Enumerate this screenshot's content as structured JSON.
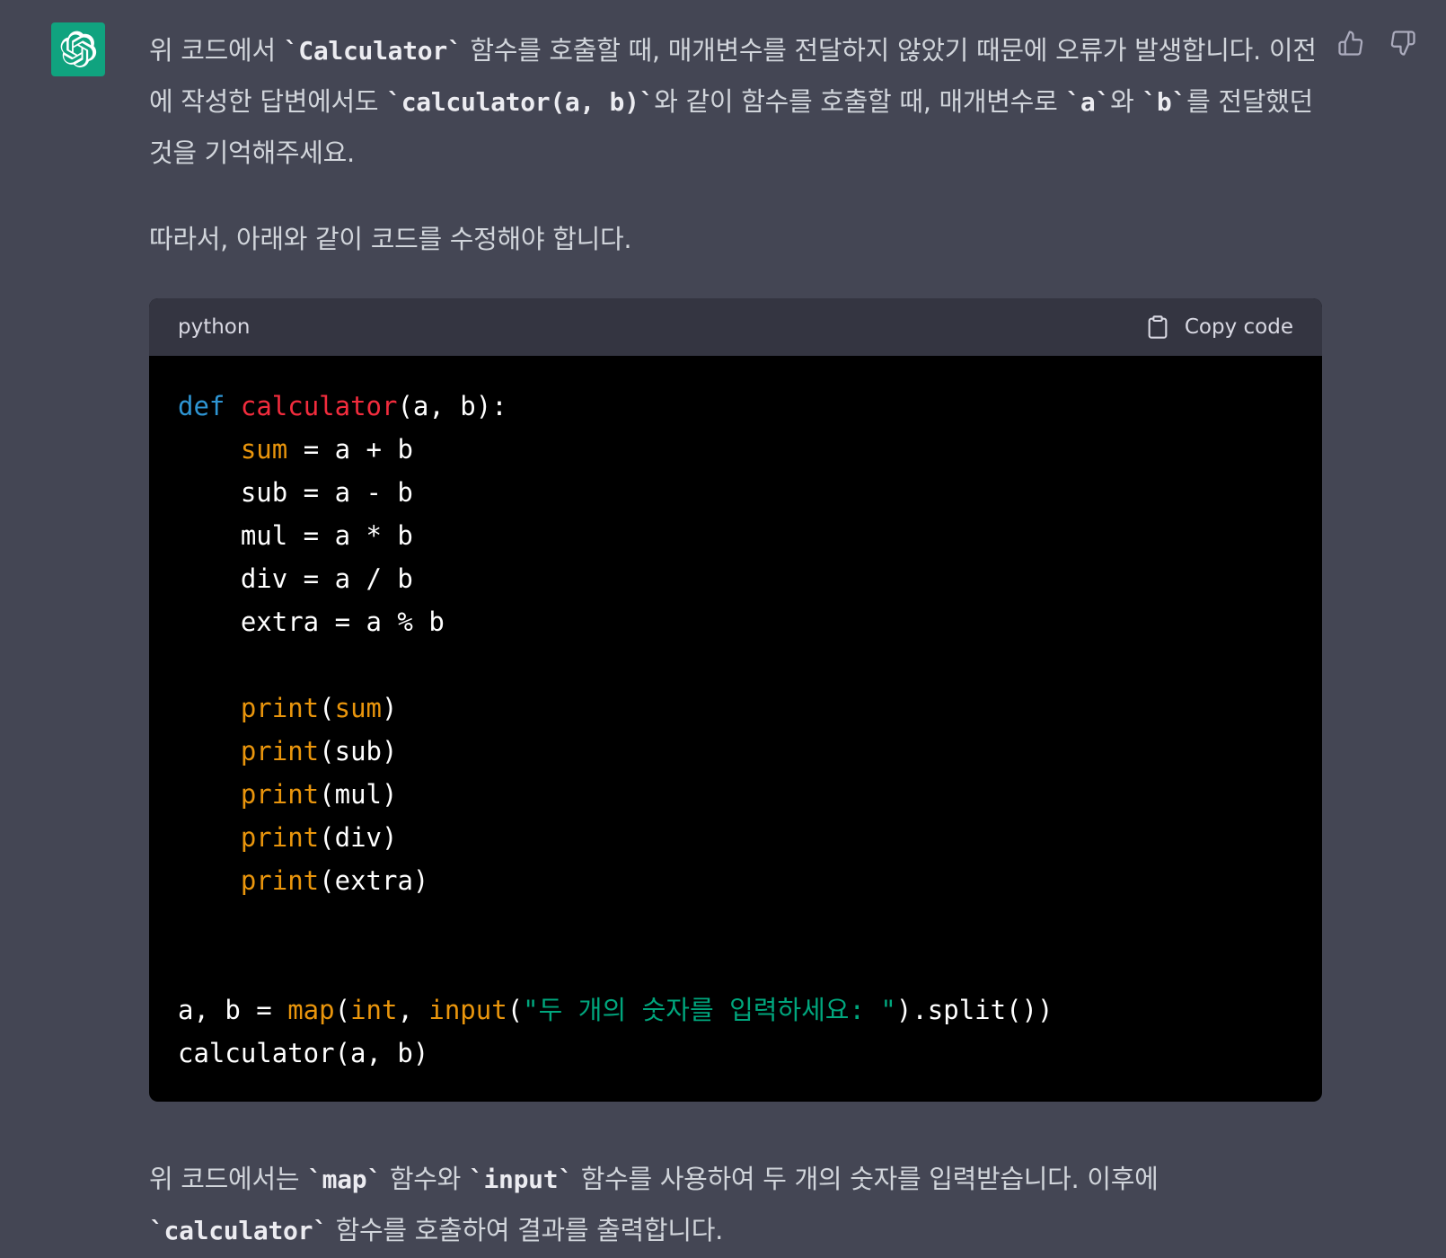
{
  "message": {
    "paragraph1": {
      "seg1": "위 코드에서 ",
      "code1": "`Calculator`",
      "seg2": " 함수를 호출할 때, 매개변수를 전달하지 않았기 때문에 오류가 발생합니다. 이전에 작성한 답변에서도 ",
      "code2": "`calculator(a, b)`",
      "seg3": "와 같이 함수를 호출할 때, 매개변수로 ",
      "code3": "`a`",
      "seg4": "와 ",
      "code4": "`b`",
      "seg5": "를 전달했던 것을 기억해주세요."
    },
    "paragraph2": "따라서, 아래와 같이 코드를 수정해야 합니다.",
    "paragraph3": {
      "seg1": "위 코드에서는 ",
      "code1": "`map`",
      "seg2": " 함수와 ",
      "code2": "`input`",
      "seg3": " 함수를 사용하여 두 개의 숫자를 입력받습니다. 이후에 ",
      "code3": "`calculator`",
      "seg4": " 함수를 호출하여 결과를 출력합니다."
    }
  },
  "code_block": {
    "language": "python",
    "copy_label": "Copy code",
    "lines": {
      "l1": {
        "kw": "def",
        "sp": " ",
        "fn": "calculator",
        "rest": "(a, b):"
      },
      "l2": {
        "indent": "    ",
        "bi": "sum",
        "rest": " = a + b"
      },
      "l3": {
        "text": "    sub = a - b"
      },
      "l4": {
        "text": "    mul = a * b"
      },
      "l5": {
        "text": "    div = a / b"
      },
      "l6": {
        "text": "    extra = a % b"
      },
      "l7": {
        "text": ""
      },
      "l8": {
        "indent": "    ",
        "bi": "print",
        "p": "(",
        "bi2": "sum",
        "rest": ")"
      },
      "l9": {
        "indent": "    ",
        "bi": "print",
        "rest": "(sub)"
      },
      "l10": {
        "indent": "    ",
        "bi": "print",
        "rest": "(mul)"
      },
      "l11": {
        "indent": "    ",
        "bi": "print",
        "rest": "(div)"
      },
      "l12": {
        "indent": "    ",
        "bi": "print",
        "rest": "(extra)"
      },
      "l13": {
        "text": ""
      },
      "l14": {
        "text": ""
      },
      "l15": {
        "a": "a, b = ",
        "bi": "map",
        "p1": "(",
        "bi2": "int",
        "p2": ", ",
        "bi3": "input",
        "p3": "(",
        "str": "\"두 개의 숫자를 입력하세요: \"",
        "rest": ").split())"
      },
      "l16": {
        "text": "calculator(a, b)"
      }
    }
  },
  "icons": {
    "avatar": "openai-logo-icon",
    "thumbs_up": "thumbs-up-icon",
    "thumbs_down": "thumbs-down-icon",
    "copy": "clipboard-icon"
  },
  "colors": {
    "background": "#444654",
    "avatar_bg": "#10a37f",
    "code_bg": "#000000",
    "code_header_bg": "#343541",
    "keyword": "#2e95d3",
    "function_name": "#f22c3d",
    "builtin": "#e9950c",
    "string": "#00a67d"
  }
}
